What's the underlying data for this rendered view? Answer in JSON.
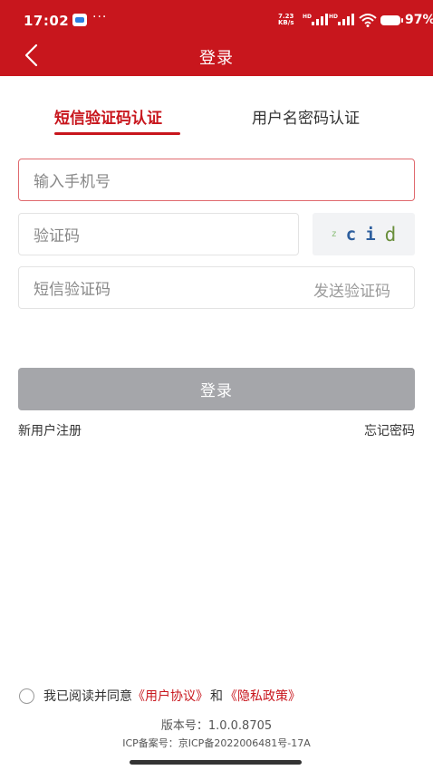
{
  "status_bar": {
    "time": "17:02",
    "dots": "···",
    "net_speed_value": "7.23",
    "net_speed_unit": "KB/s",
    "battery": "97%"
  },
  "header": {
    "title": "登录"
  },
  "tabs": [
    {
      "label": "短信验证码认证",
      "active": true
    },
    {
      "label": "用户名密码认证",
      "active": false
    }
  ],
  "form": {
    "phone_placeholder": "输入手机号",
    "captcha_placeholder": "验证码",
    "captcha_chars": [
      "z",
      "c",
      "i",
      "d"
    ],
    "sms_placeholder": "短信验证码",
    "send_code_label": "发送验证码",
    "login_label": "登录"
  },
  "links": {
    "register": "新用户注册",
    "forgot": "忘记密码"
  },
  "agreement": {
    "prefix": "我已阅读并同意",
    "user_agreement": "《用户协议》",
    "and": "和",
    "privacy_policy": "《隐私政策》",
    "checked": false
  },
  "footer": {
    "version": "版本号：1.0.0.8705",
    "icp": "ICP备案号：京ICP备2022006481号-17A"
  },
  "colors": {
    "brand": "#c8161d",
    "button_disabled": "#a5a6aa"
  }
}
